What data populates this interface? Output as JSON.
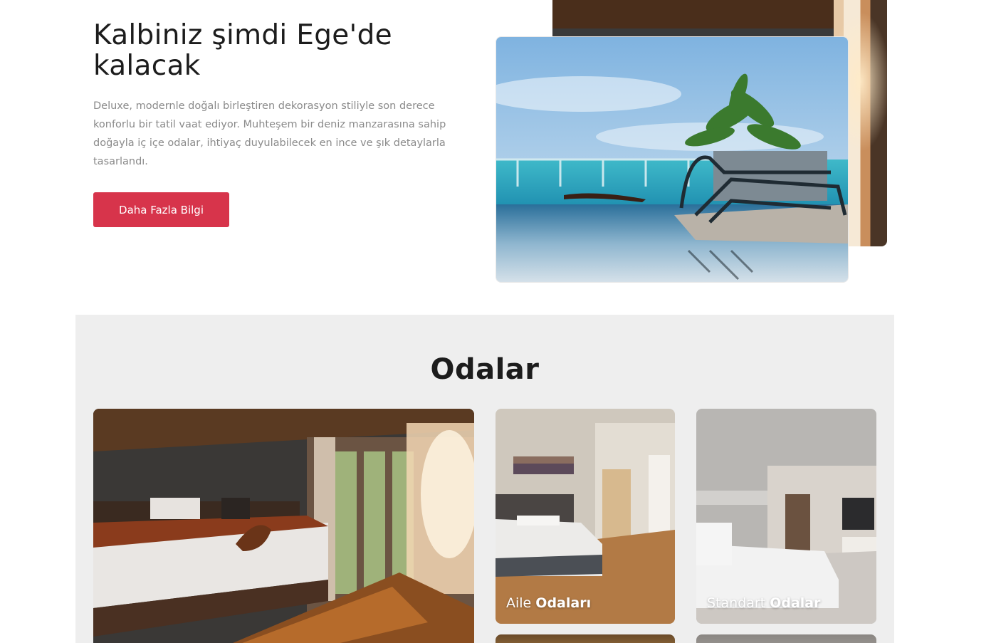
{
  "hero": {
    "title": "Kalbiniz şimdi Ege'de kalacak",
    "description": "Deluxe, modernle doğalı birleştiren dekorasyon stiliyle son derece konforlu bir tatil vaat ediyor. Muhteşem bir deniz manzarasına sahip doğayla iç içe odalar, ihtiyaç duyulabilecek en ince ve şık detaylarla tasarlandı.",
    "button_label": "Daha Fazla Bilgi",
    "accent_color": "#d7344b"
  },
  "rooms": {
    "title": "Odalar",
    "cards": [
      {
        "label_light": "",
        "label_bold": ""
      },
      {
        "label_light": "Aile",
        "label_bold": "Odaları"
      },
      {
        "label_light": "Standart",
        "label_bold": "Odalar"
      }
    ]
  }
}
